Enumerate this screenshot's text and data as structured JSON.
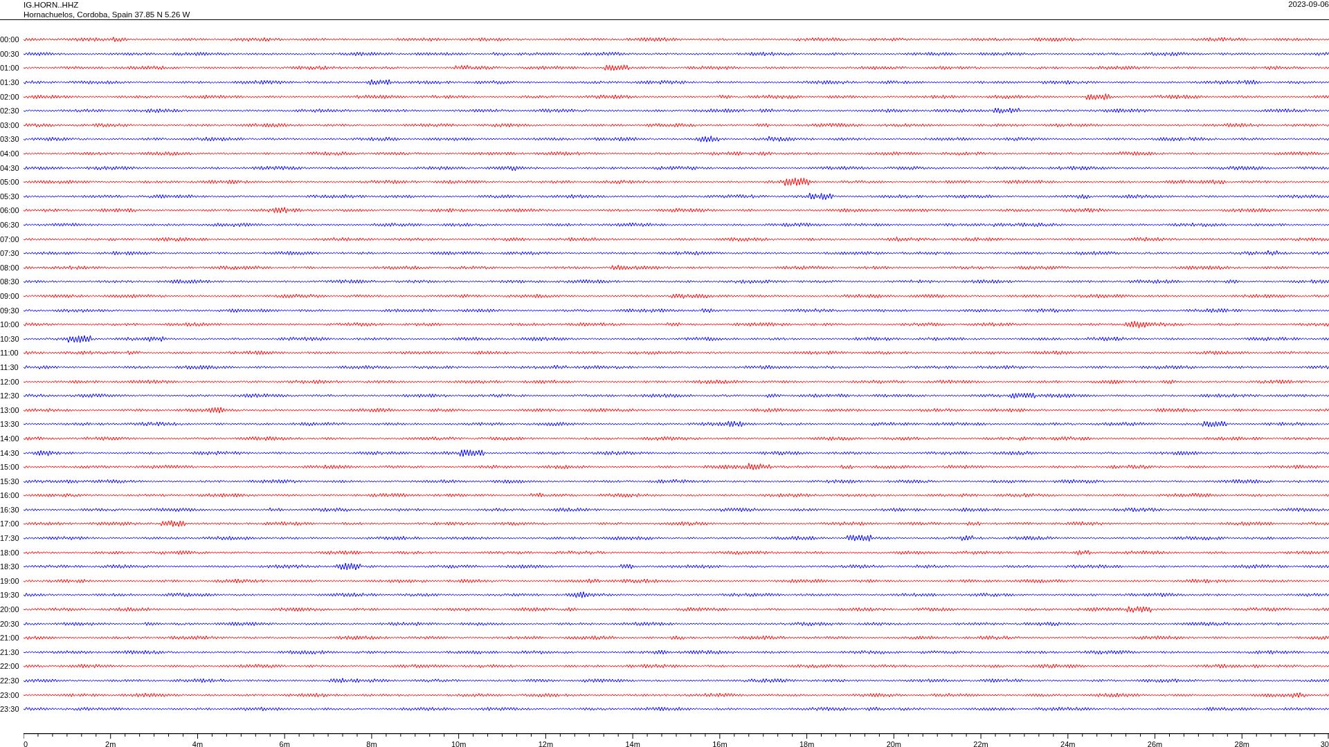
{
  "header": {
    "station": "IG.HORN..HHZ",
    "location": "Hornachuelos, Cordoba, Spain  37.85 N 5.26 W",
    "date": "2023-09-06"
  },
  "rows": [
    {
      "time": "00:00",
      "color": "#ff0000"
    },
    {
      "time": "00:30",
      "color": "#0000ff"
    },
    {
      "time": "01:00",
      "color": "#ff0000"
    },
    {
      "time": "01:30",
      "color": "#0000ff"
    },
    {
      "time": "02:00",
      "color": "#ff0000"
    },
    {
      "time": "02:30",
      "color": "#0000ff"
    },
    {
      "time": "03:00",
      "color": "#ff0000"
    },
    {
      "time": "03:30",
      "color": "#0000ff"
    },
    {
      "time": "04:00",
      "color": "#ff0000"
    },
    {
      "time": "04:30",
      "color": "#0000ff"
    },
    {
      "time": "05:00",
      "color": "#ff0000"
    },
    {
      "time": "05:30",
      "color": "#0000ff"
    },
    {
      "time": "06:00",
      "color": "#ff0000"
    },
    {
      "time": "06:30",
      "color": "#0000ff"
    },
    {
      "time": "07:00",
      "color": "#ff0000"
    },
    {
      "time": "07:30",
      "color": "#0000ff"
    },
    {
      "time": "08:00",
      "color": "#ff0000"
    },
    {
      "time": "08:30",
      "color": "#0000ff"
    },
    {
      "time": "09:00",
      "color": "#ff0000"
    },
    {
      "time": "09:30",
      "color": "#0000ff"
    },
    {
      "time": "10:00",
      "color": "#ff0000"
    },
    {
      "time": "10:30",
      "color": "#0000ff"
    },
    {
      "time": "11:00",
      "color": "#ff0000"
    },
    {
      "time": "11:30",
      "color": "#0000ff"
    },
    {
      "time": "12:00",
      "color": "#ff0000"
    },
    {
      "time": "12:30",
      "color": "#0000ff"
    },
    {
      "time": "13:00",
      "color": "#ff0000"
    },
    {
      "time": "13:30",
      "color": "#0000ff"
    },
    {
      "time": "14:00",
      "color": "#ff0000"
    },
    {
      "time": "14:30",
      "color": "#0000ff"
    },
    {
      "time": "15:00",
      "color": "#ff0000"
    },
    {
      "time": "15:30",
      "color": "#0000ff"
    },
    {
      "time": "16:00",
      "color": "#ff0000"
    },
    {
      "time": "16:30",
      "color": "#0000ff"
    },
    {
      "time": "17:00",
      "color": "#ff0000"
    },
    {
      "time": "17:30",
      "color": "#0000ff"
    },
    {
      "time": "18:00",
      "color": "#ff0000"
    },
    {
      "time": "18:30",
      "color": "#0000ff"
    },
    {
      "time": "19:00",
      "color": "#ff0000"
    },
    {
      "time": "19:30",
      "color": "#0000ff"
    },
    {
      "time": "20:00",
      "color": "#ff0000"
    },
    {
      "time": "20:30",
      "color": "#0000ff"
    },
    {
      "time": "21:00",
      "color": "#ff0000"
    },
    {
      "time": "21:30",
      "color": "#0000ff"
    },
    {
      "time": "22:00",
      "color": "#ff0000"
    },
    {
      "time": "22:30",
      "color": "#0000ff"
    },
    {
      "time": "23:00",
      "color": "#ff0000"
    },
    {
      "time": "23:30",
      "color": "#0000ff"
    }
  ],
  "time_axis": {
    "labels": [
      "0",
      "2m",
      "4m",
      "6m",
      "8m",
      "10m",
      "12m",
      "14m",
      "16m",
      "18m",
      "20m",
      "22m",
      "24m",
      "26m",
      "28m",
      "30"
    ]
  }
}
